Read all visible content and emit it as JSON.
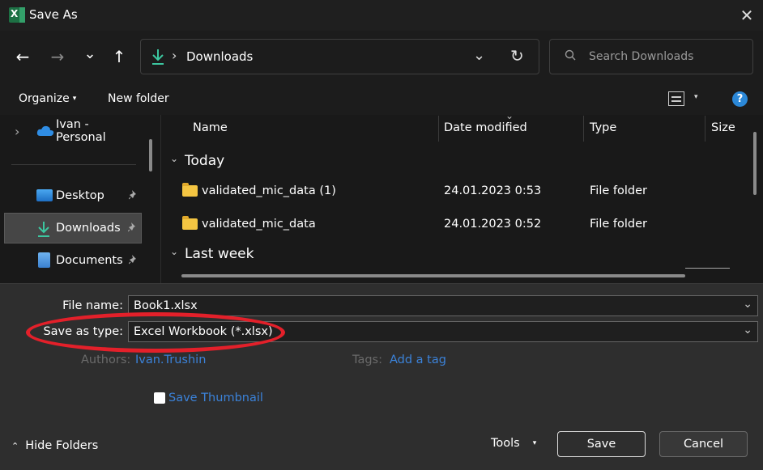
{
  "window": {
    "title": "Save As",
    "app_icon": "excel-icon",
    "close_glyph": "✕"
  },
  "nav": {
    "back_glyph": "←",
    "forward_glyph": "→",
    "recent_glyph": "⌄",
    "up_glyph": "↑",
    "address": {
      "icon": "download-icon",
      "separator": "›",
      "crumb": "Downloads",
      "dropdown_glyph": "⌄",
      "refresh_glyph": "↻"
    },
    "search": {
      "placeholder": "Search Downloads",
      "value": ""
    }
  },
  "toolbar": {
    "organize_label": "Organize",
    "organize_caret": "▾",
    "new_folder_label": "New folder",
    "view_caret": "▾",
    "help_glyph": "?"
  },
  "sidebar": {
    "items": [
      {
        "label": "Ivan - Personal",
        "icon": "onedrive-icon",
        "expand": "›",
        "pinned": false,
        "selected": false
      },
      {
        "label": "Desktop",
        "icon": "desktop-icon",
        "pinned": true,
        "selected": false
      },
      {
        "label": "Downloads",
        "icon": "download-icon",
        "pinned": true,
        "selected": true
      },
      {
        "label": "Documents",
        "icon": "documents-icon",
        "pinned": true,
        "selected": false
      }
    ],
    "pin_glyph": "📌"
  },
  "file_list": {
    "columns": [
      "Name",
      "Date modified",
      "Type",
      "Size"
    ],
    "sort_glyph": "⌄",
    "groups": [
      {
        "title": "Today",
        "collapse_glyph": "⌄",
        "rows": [
          {
            "name": "validated_mic_data (1)",
            "date": "24.01.2023 0:53",
            "type": "File folder"
          },
          {
            "name": "validated_mic_data",
            "date": "24.01.2023 0:52",
            "type": "File folder"
          }
        ]
      },
      {
        "title": "Last week",
        "collapse_glyph": "⌄",
        "rows": []
      }
    ]
  },
  "form": {
    "file_name_label": "File name:",
    "file_name_value": "Book1.xlsx",
    "save_type_label": "Save as type:",
    "save_type_value": "Excel Workbook (*.xlsx)",
    "dropdown_glyph": "⌄",
    "authors_label": "Authors:",
    "authors_value": "Ivan.Trushin",
    "tags_label": "Tags:",
    "tags_value": "Add a tag",
    "save_thumbnail_label": "Save Thumbnail",
    "save_thumbnail_checked": false
  },
  "footer": {
    "hide_folders_glyph": "⌃",
    "hide_folders_label": "Hide Folders",
    "tools_label": "Tools",
    "tools_caret": "▾",
    "save_label": "Save",
    "cancel_label": "Cancel"
  },
  "colors": {
    "annotation_ellipse": "#e3202a",
    "accent": "#2b88d8",
    "link": "#3b82d9",
    "folder": "#f4c542"
  }
}
